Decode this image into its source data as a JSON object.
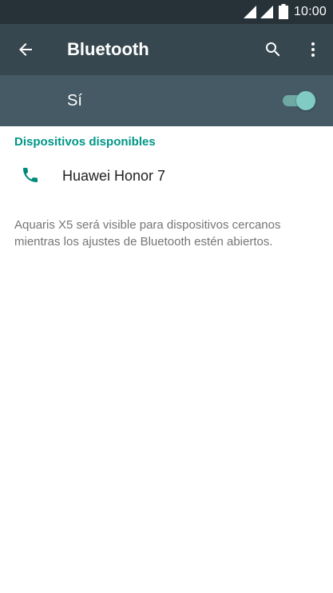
{
  "status_bar": {
    "time": "10:00",
    "icons": [
      "signal-icon",
      "signal-icon",
      "battery-icon"
    ]
  },
  "app_bar": {
    "title": "Bluetooth",
    "icons": [
      "back-arrow-icon",
      "search-icon",
      "more-vert-icon"
    ]
  },
  "master_switch": {
    "label": "Sí",
    "checked": true
  },
  "devices": {
    "section_title": "Dispositivos disponibles",
    "items": [
      {
        "name": "Huawei Honor 7",
        "icon": "phone-icon"
      }
    ]
  },
  "footer": {
    "text": "Aquaris X5 será visible para dispositivos cercanos mientras los ajustes de Bluetooth estén abiertos."
  },
  "colors": {
    "status_bar": "#263238",
    "app_bar": "#37474f",
    "switch_bar": "#455a64",
    "accent": "#009688",
    "toggle_thumb": "#80cbc4"
  }
}
